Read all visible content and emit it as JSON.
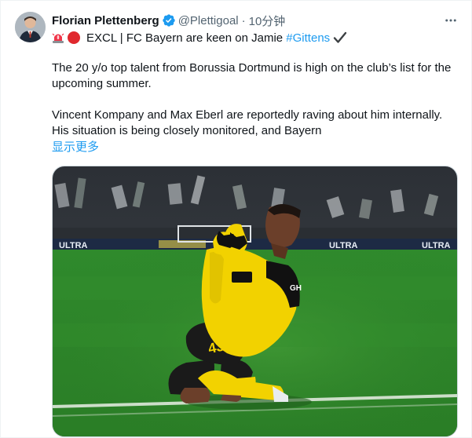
{
  "author": {
    "display_name": "Florian Plettenberg",
    "handle": "@Plettigoal",
    "separator": "·",
    "time": "10分钟",
    "verified": true
  },
  "tweet": {
    "headline_prefix": "EXCL | FC Bayern are keen on Jamie ",
    "headline_hashtag": "#Gittens",
    "paragraph1": "The 20 y/o top talent from Borussia Dortmund is high on the club’s list for the upcoming summer.",
    "paragraph2_line1": "Vincent Kompany and Max Eberl are reportedly raving about him internally.",
    "paragraph2_line2": "His situation is being closely monitored, and Bayern",
    "show_more": "显示更多"
  },
  "media": {
    "ad_boards": [
      "ULTRA",
      "ULTRA",
      "ULTRA"
    ],
    "shirt_number": "43"
  },
  "icons": {
    "verified": "verified-badge-icon",
    "more": "more-options-icon",
    "siren": "siren-emoji-icon",
    "red_circle": "red-circle-emoji-icon",
    "check": "heavy-check-mark-icon"
  },
  "colors": {
    "link": "#1d9bf0",
    "secondary_text": "#536471",
    "verified": "#1d9bf0",
    "kit_yellow": "#f2d200"
  }
}
